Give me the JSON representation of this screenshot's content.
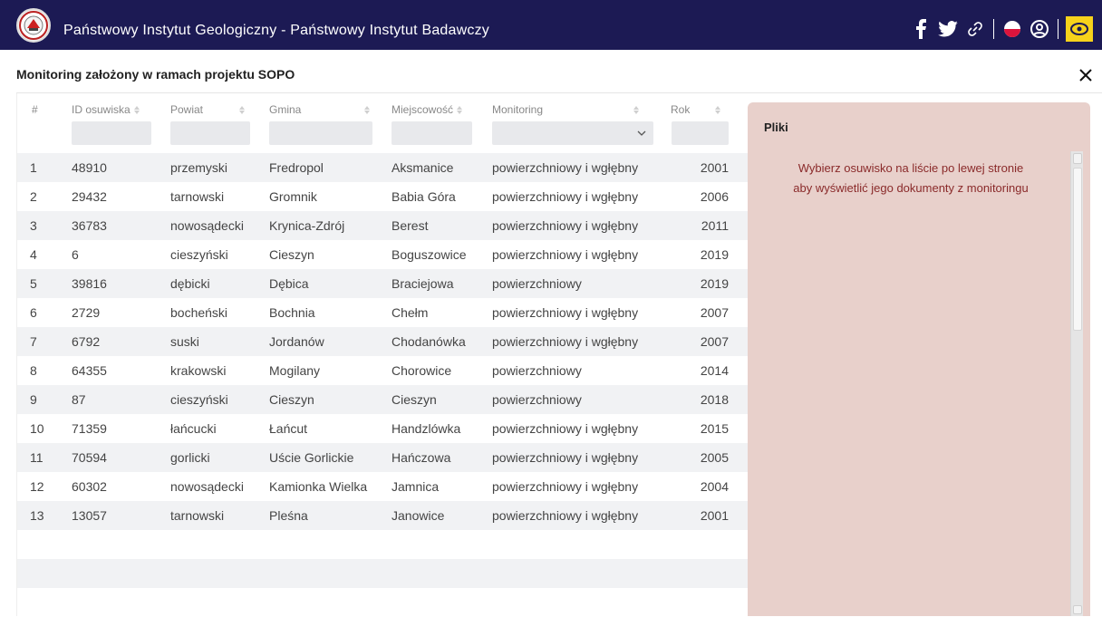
{
  "header": {
    "title": "Państwowy Instytut Geologiczny - Państwowy Instytut Badawczy",
    "icons": [
      "facebook-icon",
      "twitter-icon",
      "link-icon",
      "polish-flag-icon",
      "accessibility-icon",
      "eye-icon"
    ],
    "colors": {
      "bar": "#1c1a54",
      "eye_button": "#f6d21b"
    }
  },
  "panel": {
    "title": "Monitoring założony w ramach projektu SOPO",
    "close_icon": "close-icon"
  },
  "table": {
    "columns": {
      "num": "#",
      "id": "ID osuwiska",
      "powiat": "Powiat",
      "gmina": "Gmina",
      "miejscowosc": "Miejscowość",
      "monitoring": "Monitoring",
      "rok": "Rok"
    },
    "rows": [
      {
        "num": "1",
        "id": "48910",
        "powiat": "przemyski",
        "gmina": "Fredropol",
        "miejscowosc": "Aksmanice",
        "monitoring": "powierzchniowy i wgłębny",
        "rok": "2001"
      },
      {
        "num": "2",
        "id": "29432",
        "powiat": "tarnowski",
        "gmina": "Gromnik",
        "miejscowosc": "Babia Góra",
        "monitoring": "powierzchniowy i wgłębny",
        "rok": "2006"
      },
      {
        "num": "3",
        "id": "36783",
        "powiat": "nowosądecki",
        "gmina": "Krynica-Zdrój",
        "miejscowosc": "Berest",
        "monitoring": "powierzchniowy i wgłębny",
        "rok": "2011"
      },
      {
        "num": "4",
        "id": "6",
        "powiat": "cieszyński",
        "gmina": "Cieszyn",
        "miejscowosc": "Boguszowice",
        "monitoring": "powierzchniowy i wgłębny",
        "rok": "2019"
      },
      {
        "num": "5",
        "id": "39816",
        "powiat": "dębicki",
        "gmina": "Dębica",
        "miejscowosc": "Braciejowa",
        "monitoring": "powierzchniowy",
        "rok": "2019"
      },
      {
        "num": "6",
        "id": "2729",
        "powiat": "bocheński",
        "gmina": "Bochnia",
        "miejscowosc": "Chełm",
        "monitoring": "powierzchniowy i wgłębny",
        "rok": "2007"
      },
      {
        "num": "7",
        "id": "6792",
        "powiat": "suski",
        "gmina": "Jordanów",
        "miejscowosc": "Chodanówka",
        "monitoring": "powierzchniowy i wgłębny",
        "rok": "2007"
      },
      {
        "num": "8",
        "id": "64355",
        "powiat": "krakowski",
        "gmina": "Mogilany",
        "miejscowosc": "Chorowice",
        "monitoring": "powierzchniowy",
        "rok": "2014"
      },
      {
        "num": "9",
        "id": "87",
        "powiat": "cieszyński",
        "gmina": "Cieszyn",
        "miejscowosc": "Cieszyn",
        "monitoring": "powierzchniowy",
        "rok": "2018"
      },
      {
        "num": "10",
        "id": "71359",
        "powiat": "łańcucki",
        "gmina": "Łańcut",
        "miejscowosc": "Handzlówka",
        "monitoring": "powierzchniowy i wgłębny",
        "rok": "2015"
      },
      {
        "num": "11",
        "id": "70594",
        "powiat": "gorlicki",
        "gmina": "Uście Gorlickie",
        "miejscowosc": "Hańczowa",
        "monitoring": "powierzchniowy i wgłębny",
        "rok": "2005"
      },
      {
        "num": "12",
        "id": "60302",
        "powiat": "nowosądecki",
        "gmina": "Kamionka Wielka",
        "miejscowosc": "Jamnica",
        "monitoring": "powierzchniowy i wgłębny",
        "rok": "2004"
      },
      {
        "num": "13",
        "id": "13057",
        "powiat": "tarnowski",
        "gmina": "Pleśna",
        "miejscowosc": "Janowice",
        "monitoring": "powierzchniowy i wgłębny",
        "rok": "2001"
      }
    ]
  },
  "files": {
    "title": "Pliki",
    "message_line1": "Wybierz osuwisko na liście po lewej stronie",
    "message_line2": "aby wyświetlić jego dokumenty z monitoringu",
    "colors": {
      "background": "#e8d0cb",
      "message": "#8a2a2a"
    }
  }
}
